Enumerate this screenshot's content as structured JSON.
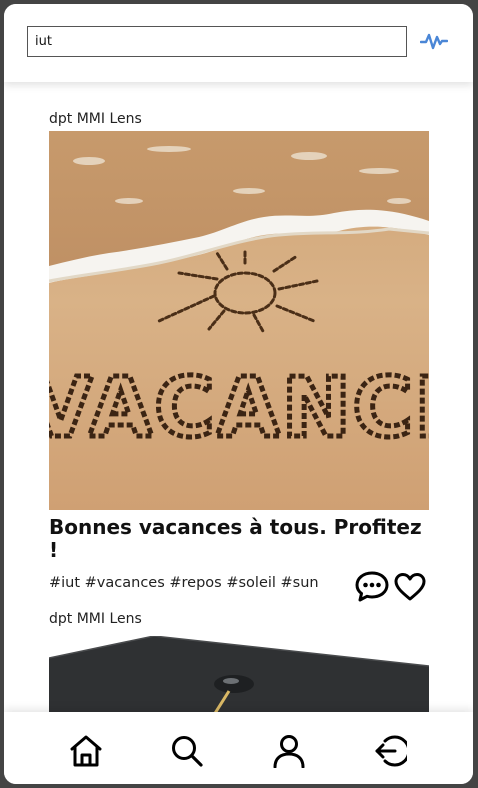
{
  "search": {
    "value": "iut",
    "placeholder": ""
  },
  "header": {
    "activity_icon": "pulse-icon",
    "accent": "#4a86d6"
  },
  "posts": [
    {
      "author": "dpt MMI Lens",
      "image_label": "beach sand drawing of a sun with word vacances",
      "image_text": "VACANCES",
      "title": "Bonnes vacances à tous. Profitez !",
      "tags": "#iut #vacances #repos #soleil #sun"
    },
    {
      "author": "dpt MMI Lens",
      "image_label": "graduation cap with tassel"
    }
  ],
  "nav": [
    {
      "icon": "home-icon"
    },
    {
      "icon": "search-icon"
    },
    {
      "icon": "user-icon"
    },
    {
      "icon": "logout-icon"
    }
  ]
}
